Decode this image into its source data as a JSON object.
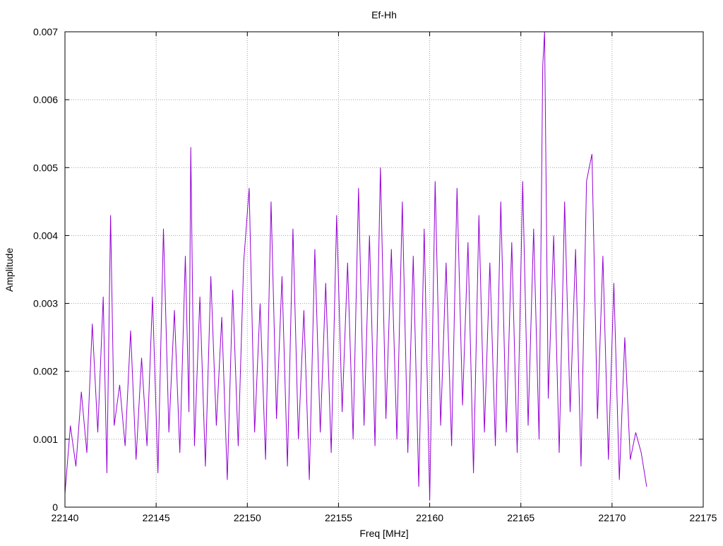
{
  "chart_data": {
    "type": "line",
    "title": "Ef-Hh",
    "xlabel": "Freq [MHz]",
    "ylabel": "Amplitude",
    "xlim": [
      22140,
      22175
    ],
    "ylim": [
      0,
      0.007
    ],
    "x_ticks": [
      22140,
      22145,
      22150,
      22155,
      22160,
      22165,
      22170,
      22175
    ],
    "y_ticks": [
      0,
      0.001,
      0.002,
      0.003,
      0.004,
      0.005,
      0.006,
      0.007
    ],
    "x_tick_labels": [
      "22140",
      "22145",
      "22150",
      "22155",
      "22160",
      "22165",
      "22170",
      "22175"
    ],
    "y_tick_labels": [
      "0",
      "0.001",
      "0.002",
      "0.003",
      "0.004",
      "0.005",
      "0.006",
      "0.007"
    ],
    "grid": true,
    "legend": "none",
    "series": [
      {
        "color": "#9400d3",
        "x": [
          22140.0,
          22140.3,
          22140.6,
          22140.9,
          22141.2,
          22141.5,
          22141.8,
          22142.1,
          22142.3,
          22142.5,
          22142.7,
          22143.0,
          22143.3,
          22143.6,
          22143.9,
          22144.2,
          22144.5,
          22144.8,
          22145.1,
          22145.4,
          22145.7,
          22146.0,
          22146.3,
          22146.6,
          22146.8,
          22146.9,
          22147.1,
          22147.4,
          22147.7,
          22148.0,
          22148.3,
          22148.6,
          22148.9,
          22149.2,
          22149.5,
          22149.8,
          22150.1,
          22150.4,
          22150.7,
          22151.0,
          22151.3,
          22151.6,
          22151.9,
          22152.2,
          22152.5,
          22152.8,
          22153.1,
          22153.4,
          22153.7,
          22154.0,
          22154.3,
          22154.6,
          22154.9,
          22155.2,
          22155.5,
          22155.8,
          22156.1,
          22156.4,
          22156.7,
          22157.0,
          22157.3,
          22157.6,
          22157.9,
          22158.2,
          22158.5,
          22158.8,
          22159.1,
          22159.4,
          22159.7,
          22160.0,
          22160.3,
          22160.6,
          22160.9,
          22161.2,
          22161.5,
          22161.8,
          22162.1,
          22162.4,
          22162.7,
          22163.0,
          22163.3,
          22163.6,
          22163.9,
          22164.2,
          22164.5,
          22164.8,
          22165.1,
          22165.4,
          22165.7,
          22166.0,
          22166.2,
          22166.3,
          22166.5,
          22166.8,
          22167.1,
          22167.4,
          22167.7,
          22168.0,
          22168.3,
          22168.6,
          22168.9,
          22169.2,
          22169.5,
          22169.8,
          22170.1,
          22170.4,
          22170.7,
          22171.0,
          22171.3,
          22171.6,
          22171.9
        ],
        "y": [
          0.0002,
          0.0012,
          0.0006,
          0.0017,
          0.0008,
          0.0027,
          0.0011,
          0.0031,
          0.0005,
          0.0043,
          0.0012,
          0.0018,
          0.0009,
          0.0026,
          0.0007,
          0.0022,
          0.0009,
          0.0031,
          0.0005,
          0.0041,
          0.0011,
          0.0029,
          0.0008,
          0.0037,
          0.0014,
          0.0053,
          0.0009,
          0.0031,
          0.0006,
          0.0034,
          0.0012,
          0.0028,
          0.0004,
          0.0032,
          0.0009,
          0.0036,
          0.0047,
          0.0011,
          0.003,
          0.0007,
          0.0045,
          0.0013,
          0.0034,
          0.0006,
          0.0041,
          0.001,
          0.0029,
          0.0004,
          0.0038,
          0.0011,
          0.0033,
          0.0008,
          0.0043,
          0.0014,
          0.0036,
          0.001,
          0.0047,
          0.0012,
          0.004,
          0.0009,
          0.005,
          0.0013,
          0.0038,
          0.001,
          0.0045,
          0.0008,
          0.0037,
          0.0003,
          0.0041,
          0.0001,
          0.0048,
          0.0012,
          0.0036,
          0.0009,
          0.0047,
          0.0015,
          0.0039,
          0.0005,
          0.0043,
          0.0011,
          0.0036,
          0.0009,
          0.0045,
          0.0011,
          0.0039,
          0.0008,
          0.0048,
          0.0012,
          0.0041,
          0.001,
          0.0065,
          0.007,
          0.0016,
          0.004,
          0.0008,
          0.0045,
          0.0014,
          0.0038,
          0.0006,
          0.0048,
          0.0052,
          0.0013,
          0.0037,
          0.0007,
          0.0033,
          0.0004,
          0.0025,
          0.0007,
          0.0011,
          0.0008,
          0.0003
        ]
      }
    ]
  }
}
